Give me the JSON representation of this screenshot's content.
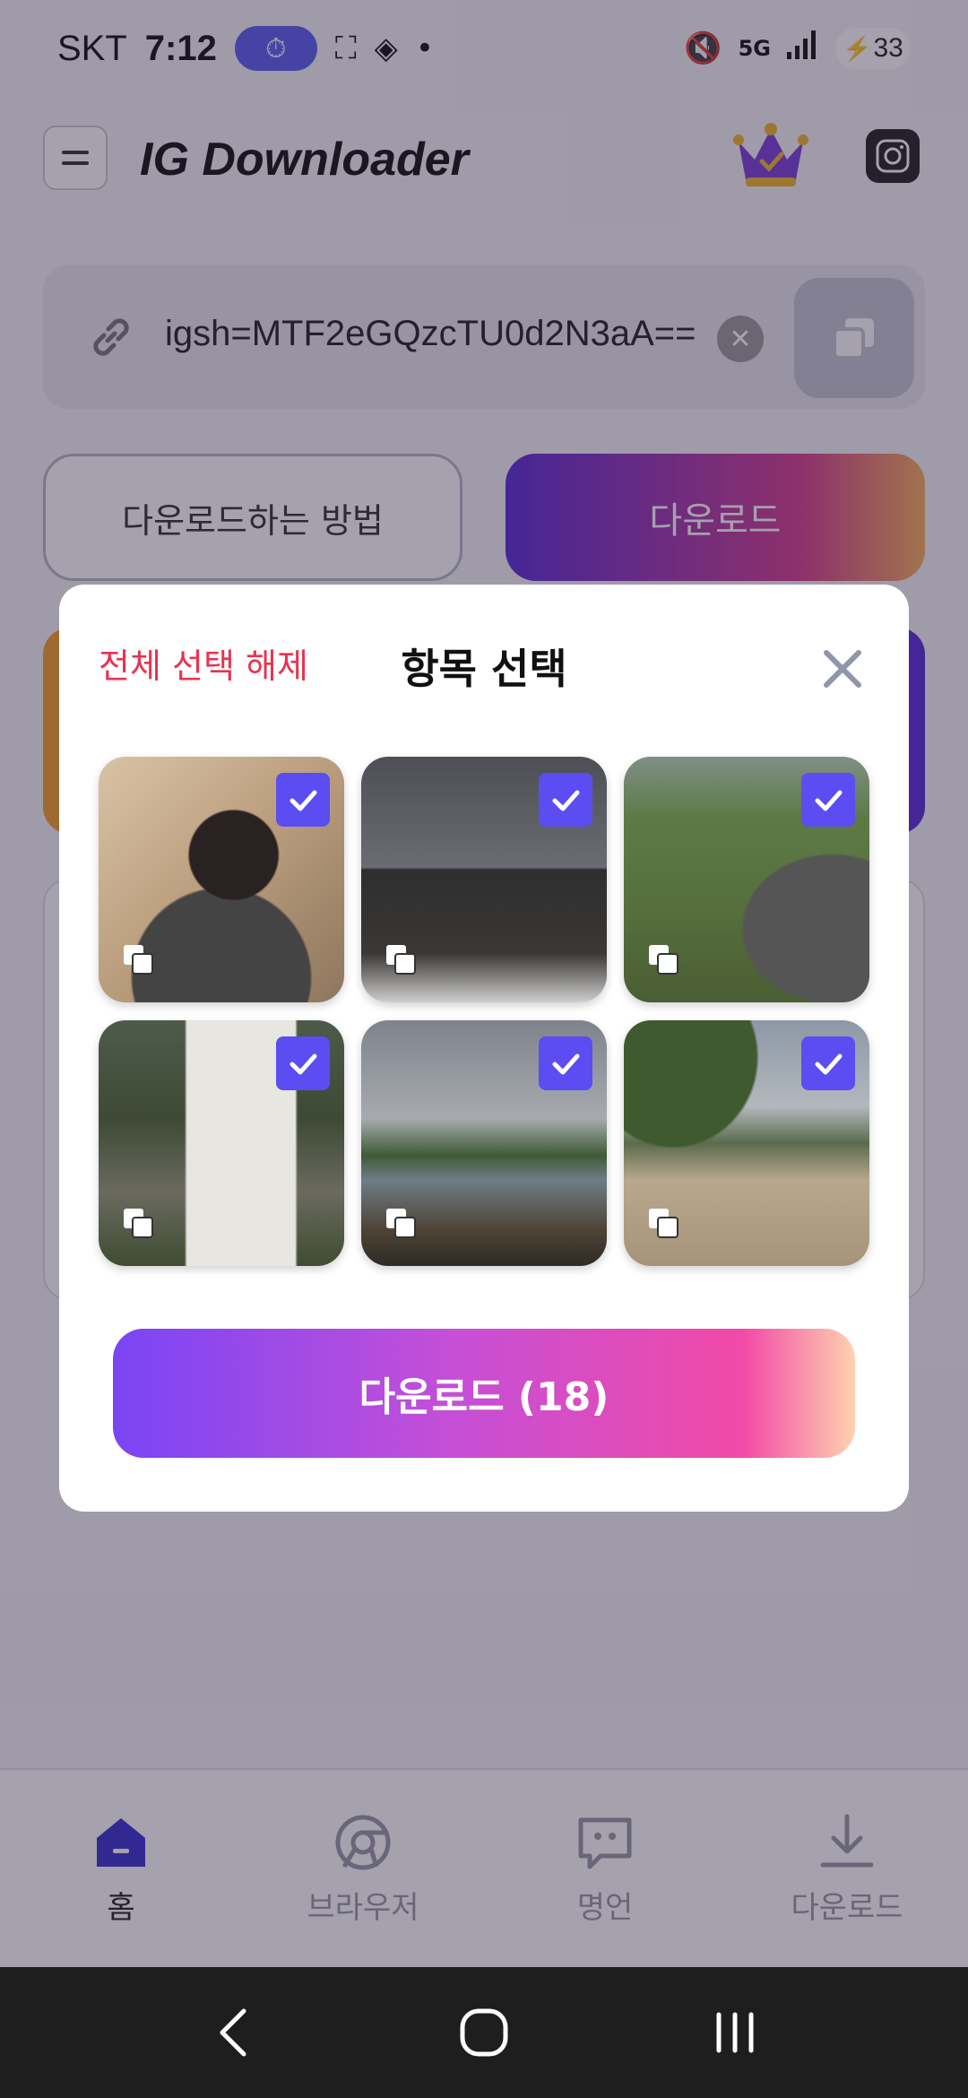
{
  "status_bar": {
    "carrier": "SKT",
    "time": "7:12",
    "battery": "33",
    "network": "5G"
  },
  "header": {
    "title": "IG Downloader"
  },
  "url_input": {
    "value": "igsh=MTF2eGQzcTU0d2N3aA=="
  },
  "actions": {
    "howto_label": "다운로드하는 방법",
    "download_label": "다운로드"
  },
  "modal": {
    "deselect_all": "전체 선택 해제",
    "title": "항목 선택",
    "download_button": "다운로드 (18)",
    "items": [
      {
        "selected": true,
        "scene": "selfie-sand"
      },
      {
        "selected": true,
        "scene": "car-mirror-selfie"
      },
      {
        "selected": true,
        "scene": "park-grass"
      },
      {
        "selected": true,
        "scene": "trail-signboard"
      },
      {
        "selected": true,
        "scene": "lake-playground"
      },
      {
        "selected": true,
        "scene": "beach-playground"
      }
    ]
  },
  "bottom_nav": {
    "items": [
      {
        "label": "홈",
        "icon": "home-icon",
        "active": true
      },
      {
        "label": "브라우저",
        "icon": "browser-icon",
        "active": false
      },
      {
        "label": "명언",
        "icon": "quote-icon",
        "active": false
      },
      {
        "label": "다운로드",
        "icon": "download-icon",
        "active": false
      }
    ]
  },
  "colors": {
    "accent": "#5b4df2",
    "deselect": "#e8334f"
  }
}
